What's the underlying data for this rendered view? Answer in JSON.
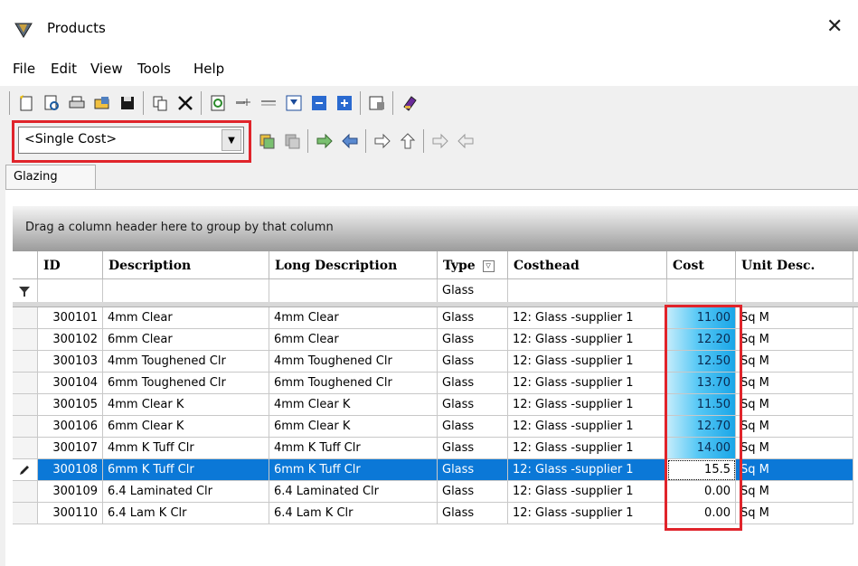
{
  "window": {
    "title": "Products"
  },
  "menu": [
    {
      "label": "File"
    },
    {
      "label": "Edit"
    },
    {
      "label": "View"
    },
    {
      "label": "Tools"
    },
    {
      "label": "Help"
    }
  ],
  "toolbar": {
    "cost_selector": "<Single Cost>"
  },
  "tabs": [
    {
      "label": "Glazing"
    }
  ],
  "grid": {
    "group_hint": "Drag a column header here to group by that column",
    "columns": [
      "ID",
      "Description",
      "Long Description",
      "Type",
      "Costhead",
      "Cost",
      "Unit Desc."
    ],
    "filter_type": "Glass",
    "rows": [
      {
        "id": "300101",
        "desc": "4mm Clear",
        "long": "4mm Clear",
        "type": "Glass",
        "costhead": "12: Glass -supplier 1",
        "cost": "11.00",
        "unit": "Sq M"
      },
      {
        "id": "300102",
        "desc": "6mm Clear",
        "long": "6mm Clear",
        "type": "Glass",
        "costhead": "12: Glass -supplier 1",
        "cost": "12.20",
        "unit": "Sq M"
      },
      {
        "id": "300103",
        "desc": "4mm Toughened Clr",
        "long": "4mm Toughened Clr",
        "type": "Glass",
        "costhead": "12: Glass -supplier 1",
        "cost": "12.50",
        "unit": "Sq M"
      },
      {
        "id": "300104",
        "desc": "6mm Toughened Clr",
        "long": "6mm Toughened Clr",
        "type": "Glass",
        "costhead": "12: Glass -supplier 1",
        "cost": "13.70",
        "unit": "Sq M"
      },
      {
        "id": "300105",
        "desc": "4mm Clear K",
        "long": "4mm Clear K",
        "type": "Glass",
        "costhead": "12: Glass -supplier 1",
        "cost": "11.50",
        "unit": "Sq M"
      },
      {
        "id": "300106",
        "desc": "6mm Clear K",
        "long": "6mm Clear K",
        "type": "Glass",
        "costhead": "12: Glass -supplier 1",
        "cost": "12.70",
        "unit": "Sq M"
      },
      {
        "id": "300107",
        "desc": "4mm K Tuff Clr",
        "long": "4mm K Tuff Clr",
        "type": "Glass",
        "costhead": "12: Glass -supplier 1",
        "cost": "14.00",
        "unit": "Sq M"
      },
      {
        "id": "300108",
        "desc": "6mm K Tuff Clr",
        "long": "6mm K Tuff Clr",
        "type": "Glass",
        "costhead": "12: Glass -supplier 1",
        "cost": "15.5",
        "unit": "Sq M"
      },
      {
        "id": "300109",
        "desc": "6.4 Laminated Clr",
        "long": "6.4 Laminated Clr",
        "type": "Glass",
        "costhead": "12: Glass -supplier 1",
        "cost": "0.00",
        "unit": "Sq M"
      },
      {
        "id": "300110",
        "desc": "6.4 Lam K Clr",
        "long": "6.4 Lam K Clr",
        "type": "Glass",
        "costhead": "12: Glass -supplier 1",
        "cost": "0.00",
        "unit": "Sq M"
      }
    ]
  },
  "colors": {
    "highlight": "#e0242b",
    "selection": "#0b78d7",
    "cost_gradient": "#1aa6e8"
  }
}
